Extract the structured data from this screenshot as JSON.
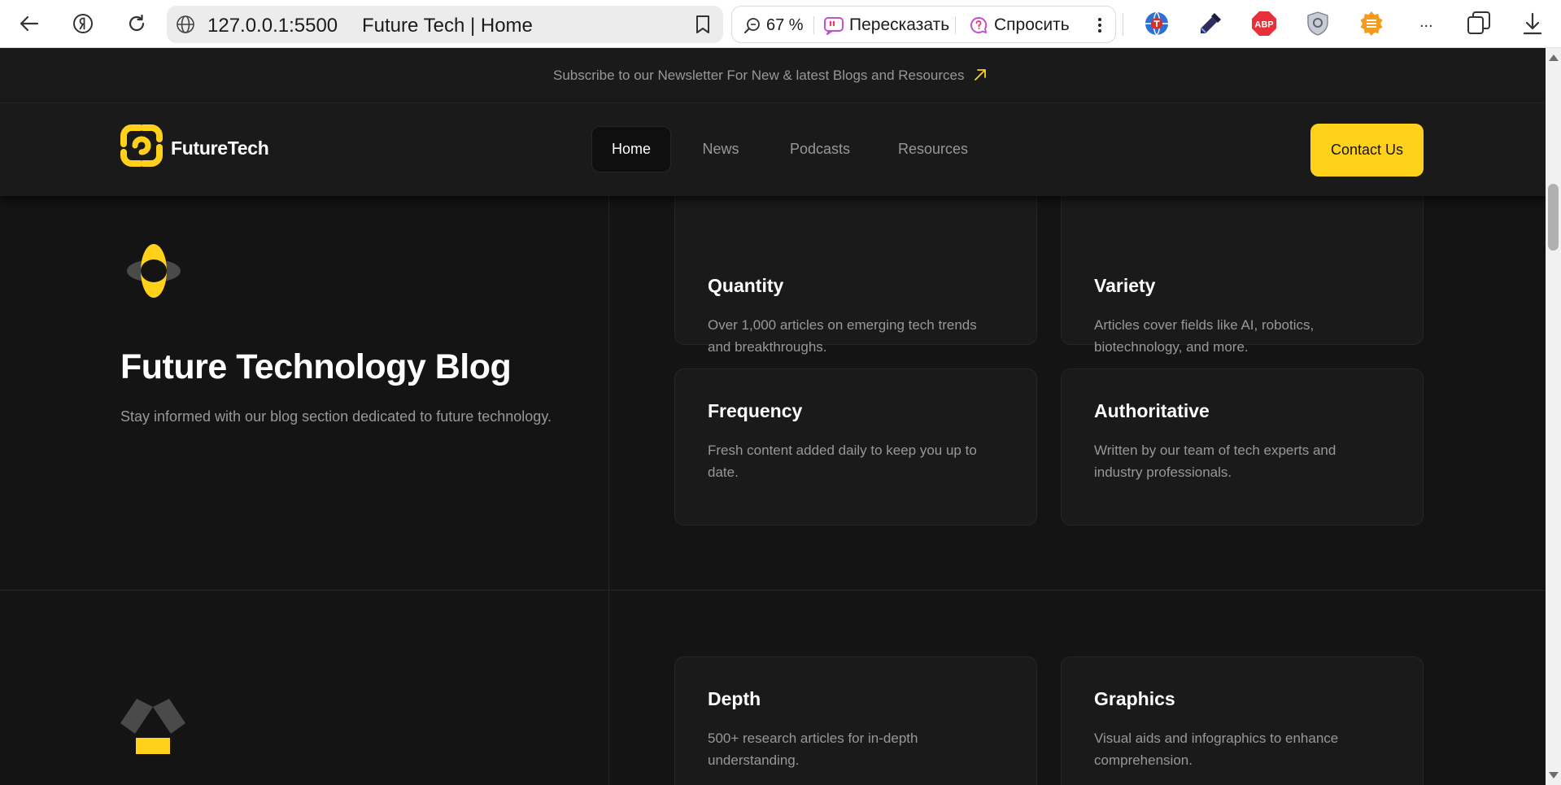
{
  "browser": {
    "url": "127.0.0.1:5500",
    "tab_title": "Future Tech | Home",
    "zoom": "67 %",
    "retell_label": "Пересказать",
    "ask_label": "Спросить",
    "more_label": "...",
    "icons": [
      "back-icon",
      "yandex-icon",
      "reload-icon",
      "globe-icon",
      "bookmark-icon",
      "zoom-icon",
      "retell-icon",
      "ask-icon",
      "kebab-icon",
      "translate-extension-icon",
      "eyedropper-extension-icon",
      "adblock-extension-icon",
      "shield-extension-icon",
      "menu-extension-icon",
      "tabs-icon",
      "download-icon"
    ],
    "abp_label": "ABP"
  },
  "banner": {
    "text": "Subscribe to our Newsletter For New & latest Blogs and Resources"
  },
  "nav": {
    "brand": "FutureTech",
    "items": [
      {
        "label": "Home",
        "active": true
      },
      {
        "label": "News",
        "active": false
      },
      {
        "label": "Podcasts",
        "active": false
      },
      {
        "label": "Resources",
        "active": false
      }
    ],
    "contact_label": "Contact Us"
  },
  "hero": {
    "title": "Future Technology Blog",
    "description": "Stay informed with our blog section dedicated to future technology."
  },
  "features": [
    {
      "title": "Quantity",
      "text": "Over 1,000 articles on emerging tech trends and breakthroughs."
    },
    {
      "title": "Variety",
      "text": "Articles cover fields like AI, robotics, biotechnology, and more."
    },
    {
      "title": "Frequency",
      "text": "Fresh content added daily to keep you up to date."
    },
    {
      "title": "Authoritative",
      "text": "Written by our team of tech experts and industry professionals."
    },
    {
      "title": "Depth",
      "text": "500+ research articles for in-depth understanding."
    },
    {
      "title": "Graphics",
      "text": "Visual aids and infographics to enhance comprehension."
    }
  ],
  "colors": {
    "accent": "#ffd11a",
    "background": "#141414",
    "panel": "#1a1a1a",
    "border": "#262626",
    "muted_text": "#98989a"
  }
}
